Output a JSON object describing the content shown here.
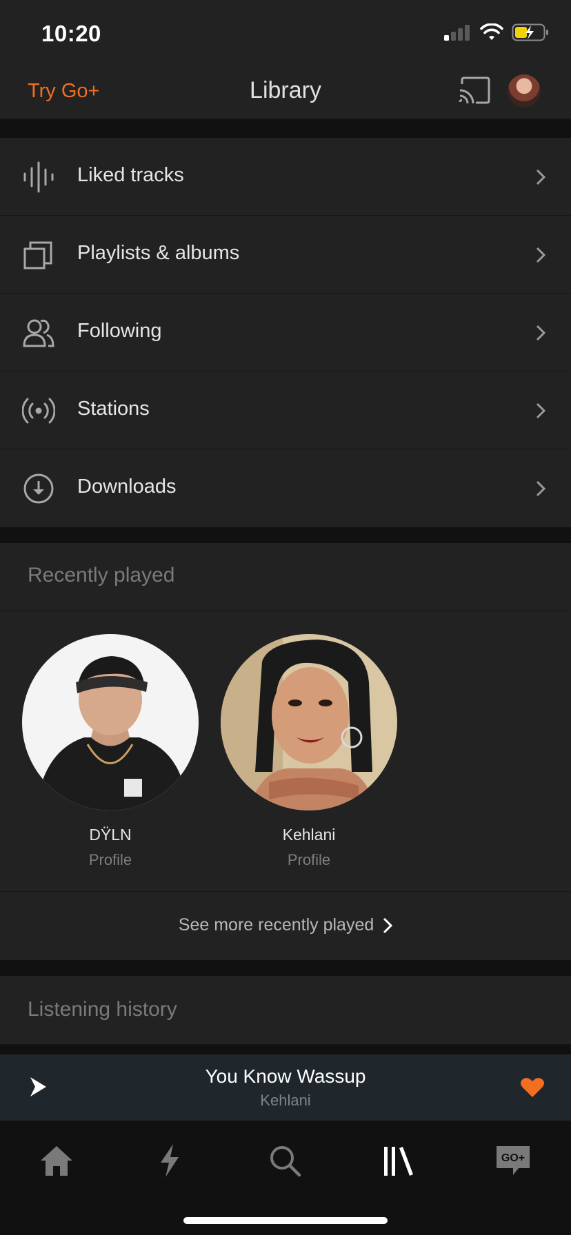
{
  "status_bar": {
    "time": "10:20"
  },
  "header": {
    "try_go": "Try Go+",
    "title": "Library"
  },
  "menu": [
    {
      "label": "Liked tracks",
      "icon": "waveform-icon"
    },
    {
      "label": "Playlists & albums",
      "icon": "stacked-squares-icon"
    },
    {
      "label": "Following",
      "icon": "people-icon"
    },
    {
      "label": "Stations",
      "icon": "broadcast-icon"
    },
    {
      "label": "Downloads",
      "icon": "download-icon"
    }
  ],
  "recently_played": {
    "heading": "Recently played",
    "items": [
      {
        "name": "DŸLN",
        "type": "Profile"
      },
      {
        "name": "Kehlani",
        "type": "Profile"
      }
    ],
    "see_more": "See more recently played"
  },
  "listening_history": {
    "heading": "Listening history"
  },
  "player": {
    "title": "You Know Wassup",
    "artist": "Kehlani",
    "liked": true
  },
  "tabs": [
    "home-icon",
    "lightning-icon",
    "search-icon",
    "library-icon",
    "go-plus-icon"
  ],
  "colors": {
    "accent": "#f26f22",
    "background": "#222222",
    "player_bg": "#1f272d"
  }
}
